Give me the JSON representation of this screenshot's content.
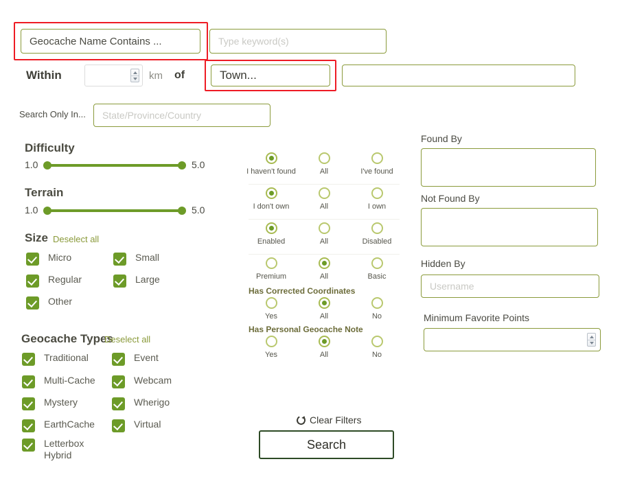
{
  "search_row": {
    "name_field_value": "Geocache Name Contains ...",
    "keyword_placeholder": "Type keyword(s)"
  },
  "within_row": {
    "within_label": "Within",
    "distance_value": "",
    "unit_label": "km",
    "of_label": "of",
    "town_value": "Town...",
    "location_value": ""
  },
  "region_row": {
    "label": "Search Only In...",
    "placeholder": "State/Province/Country"
  },
  "difficulty": {
    "title": "Difficulty",
    "min": "1.0",
    "max": "5.0"
  },
  "terrain": {
    "title": "Terrain",
    "min": "1.0",
    "max": "5.0"
  },
  "size": {
    "title": "Size",
    "deselect_label": "Deselect all",
    "items": [
      {
        "label": "Micro",
        "checked": true
      },
      {
        "label": "Small",
        "checked": true
      },
      {
        "label": "Regular",
        "checked": true
      },
      {
        "label": "Large",
        "checked": true
      },
      {
        "label": "Other",
        "checked": true
      }
    ]
  },
  "geocache_types": {
    "title": "Geocache Types",
    "deselect_label": "Deselect all",
    "items": [
      {
        "label": "Traditional",
        "checked": true
      },
      {
        "label": "Event",
        "checked": true
      },
      {
        "label": "Multi-Cache",
        "checked": true
      },
      {
        "label": "Webcam",
        "checked": true
      },
      {
        "label": "Mystery",
        "checked": true
      },
      {
        "label": "Wherigo",
        "checked": true
      },
      {
        "label": "EarthCache",
        "checked": true
      },
      {
        "label": "Virtual",
        "checked": true
      },
      {
        "label": "Letterbox Hybrid",
        "checked": true
      }
    ]
  },
  "radio_groups": [
    {
      "section": "",
      "options": [
        {
          "label": "I haven't found",
          "selected": true
        },
        {
          "label": "All",
          "selected": false
        },
        {
          "label": "I've found",
          "selected": false
        }
      ]
    },
    {
      "section": "",
      "options": [
        {
          "label": "I don't own",
          "selected": true
        },
        {
          "label": "All",
          "selected": false
        },
        {
          "label": "I own",
          "selected": false
        }
      ]
    },
    {
      "section": "",
      "options": [
        {
          "label": "Enabled",
          "selected": true
        },
        {
          "label": "All",
          "selected": false
        },
        {
          "label": "Disabled",
          "selected": false
        }
      ]
    },
    {
      "section": "",
      "options": [
        {
          "label": "Premium",
          "selected": false
        },
        {
          "label": "All",
          "selected": true
        },
        {
          "label": "Basic",
          "selected": false
        }
      ]
    },
    {
      "section": "Has Corrected Coordinates",
      "options": [
        {
          "label": "Yes",
          "selected": false
        },
        {
          "label": "All",
          "selected": true
        },
        {
          "label": "No",
          "selected": false
        }
      ]
    },
    {
      "section": "Has Personal Geocache Note",
      "options": [
        {
          "label": "Yes",
          "selected": false
        },
        {
          "label": "All",
          "selected": true
        },
        {
          "label": "No",
          "selected": false
        }
      ]
    }
  ],
  "right_column": {
    "found_by_label": "Found By",
    "found_by_value": "",
    "not_found_by_label": "Not Found By",
    "not_found_by_value": "",
    "hidden_by_label": "Hidden By",
    "hidden_by_placeholder": "Username",
    "min_fav_label": "Minimum Favorite Points",
    "min_fav_value": ""
  },
  "footer": {
    "clear_filters_label": "Clear Filters",
    "search_label": "Search"
  },
  "colors": {
    "accent_green": "#6d9b28",
    "border_olive": "#8a9a3a",
    "highlight_red": "#ee1b24",
    "button_border": "#2d4a25"
  }
}
